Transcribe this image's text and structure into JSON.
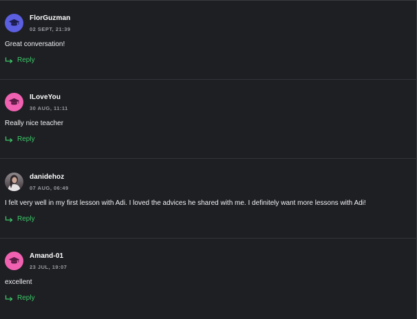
{
  "comments": [
    {
      "username": "FlorGuzman",
      "timestamp": "02 SEPT, 21:39",
      "text": "Great conversation!",
      "avatar": "graduation-cap-avatar",
      "avatar_color": "#5b5fe0",
      "reply_label": "Reply"
    },
    {
      "username": "ILoveYou",
      "timestamp": "30 AUG, 11:11",
      "text": "Really nice teacher",
      "avatar": "graduation-cap-avatar",
      "avatar_color": "#f062b1",
      "reply_label": "Reply"
    },
    {
      "username": "danidehoz",
      "timestamp": "07 AUG, 06:49",
      "text": "I felt very well in my first lesson with Adi. I loved the advices he shared with me. I definitely want more lessons with Adi!",
      "avatar": "user-photo-avatar",
      "reply_label": "Reply"
    },
    {
      "username": "Amand-01",
      "timestamp": "23 JUL, 19:07",
      "text": "excellent",
      "avatar": "graduation-cap-avatar",
      "avatar_color": "#f062b1",
      "reply_label": "Reply"
    }
  ],
  "colors": {
    "background": "#1e1f23",
    "reply_accent": "#3cc768",
    "username": "#ffffff",
    "timestamp": "#9b9ca2"
  }
}
